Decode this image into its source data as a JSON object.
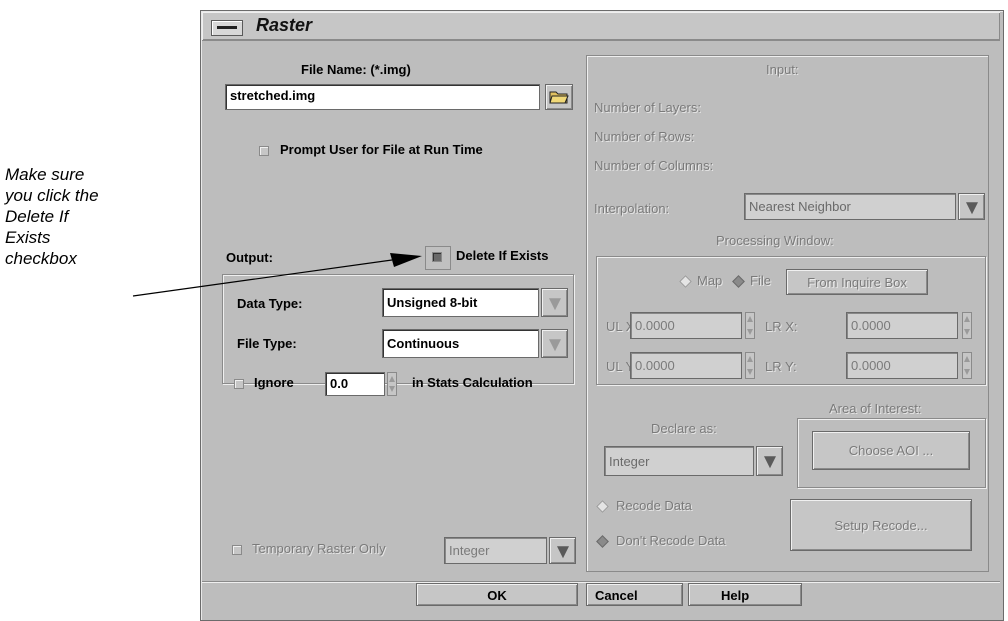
{
  "callout": {
    "lines": [
      "Make sure",
      "you click the",
      "Delete If",
      "Exists",
      "checkbox"
    ]
  },
  "window": {
    "title": "Raster"
  },
  "file": {
    "label": "File Name: (*.img)",
    "value": "stretched.img",
    "prompt_label": "Prompt User for File at Run Time"
  },
  "output": {
    "label": "Output:",
    "delete_if_exists_label": "Delete If Exists",
    "delete_if_exists_checked": true,
    "data_type_label": "Data Type:",
    "data_type_value": "Unsigned 8-bit",
    "file_type_label": "File Type:",
    "file_type_value": "Continuous",
    "ignore_label": "Ignore",
    "ignore_value": "0.0",
    "stats_label": "in Stats Calculation",
    "temporary_label": "Temporary Raster Only",
    "temporary_type": "Integer"
  },
  "input": {
    "header": "Input:",
    "layers_label": "Number of Layers:",
    "rows_label": "Number of Rows:",
    "columns_label": "Number of Columns:",
    "interpolation_label": "Interpolation:",
    "interpolation_value": "Nearest Neighbor",
    "processing_window_label": "Processing Window:",
    "map_label": "Map",
    "file_label": "File",
    "file_selected": true,
    "inquire_button": "From Inquire Box",
    "ulx_label": "UL X:",
    "ulx_value": "0.0000",
    "lrx_label": "LR X:",
    "lrx_value": "0.0000",
    "uly_label": "UL Y:",
    "uly_value": "0.0000",
    "lry_label": "LR Y:",
    "lry_value": "0.0000",
    "declare_label": "Declare as:",
    "declare_value": "Integer",
    "aoi_label": "Area of Interest:",
    "aoi_button": "Choose AOI ...",
    "recode_label": "Recode Data",
    "dont_recode_label": "Don't Recode Data",
    "dont_recode_selected": true,
    "setup_recode_button": "Setup Recode..."
  },
  "buttons": {
    "ok": "OK",
    "cancel": "Cancel",
    "help": "Help"
  }
}
